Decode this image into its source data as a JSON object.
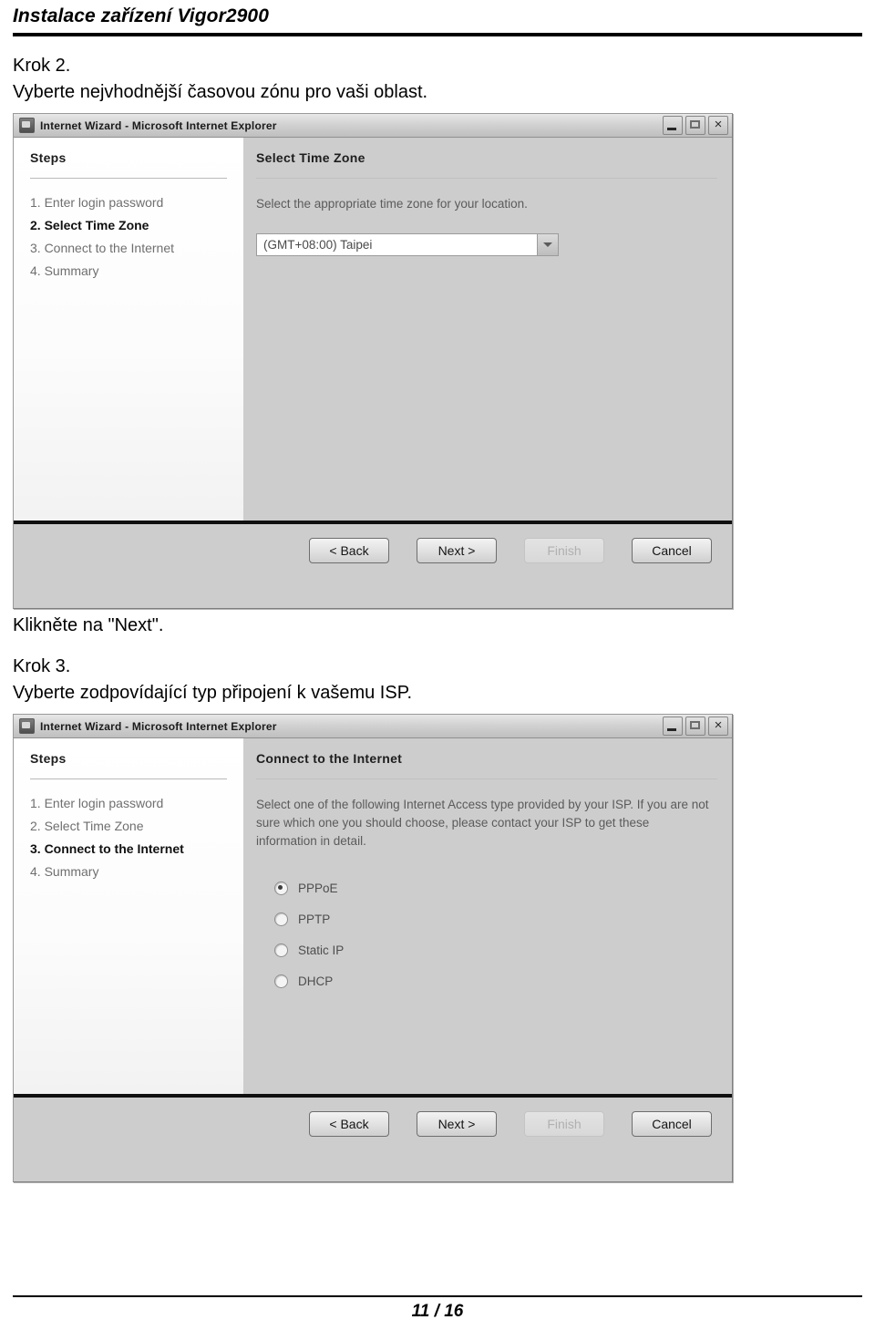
{
  "document": {
    "title": "Instalace zařízení Vigor2900",
    "footer_page": "11 / 16"
  },
  "steps_text": {
    "step2_heading": "Krok 2.",
    "step2_instruction": "Vyberte nejvhodnější časovou zónu pro vaši oblast.",
    "click_next": "Klikněte na \"Next\".",
    "step3_heading": "Krok 3.",
    "step3_instruction": "Vyberte zodpovídající typ připojení k vašemu ISP."
  },
  "dialog_common": {
    "window_title": "Internet Wizard - Microsoft Internet Explorer",
    "steps_pane_title": "Steps",
    "step_labels": [
      "1. Enter login password",
      "2. Select Time Zone",
      "3. Connect to the Internet",
      "4. Summary"
    ],
    "window_controls": {
      "minimize": "minimize-icon",
      "maximize": "maximize-icon",
      "close": "×"
    },
    "buttons": {
      "back": "< Back",
      "next": "Next >",
      "finish": "Finish",
      "cancel": "Cancel"
    }
  },
  "dialog_timezone": {
    "content_title": "Select Time Zone",
    "description": "Select the appropriate time zone for your location.",
    "selected_timezone": "(GMT+08:00) Taipei",
    "active_step_index": 1
  },
  "dialog_internet": {
    "content_title": "Connect to the Internet",
    "description": "Select one of the following Internet Access type provided by your ISP. If you are not sure which one you should choose, please contact your ISP to get these information in detail.",
    "active_step_index": 2,
    "access_types": [
      {
        "label": "PPPoE",
        "selected": true
      },
      {
        "label": "PPTP",
        "selected": false
      },
      {
        "label": "Static IP",
        "selected": false
      },
      {
        "label": "DHCP",
        "selected": false
      }
    ],
    "selected_access_type": "PPPoE"
  },
  "colors": {
    "dialog_background": "#cdcdcd",
    "steps_pane_background": "#ffffff",
    "divider": "#101010",
    "active_step_text": "#111111",
    "inactive_step_text": "#6f6f6f"
  }
}
